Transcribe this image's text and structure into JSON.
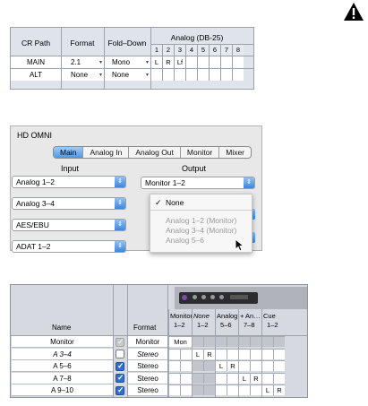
{
  "icons": {
    "warning": "warning-triangle-icon",
    "pointer": "mouse-pointer-icon",
    "checkmark": "checkmark-icon"
  },
  "colors": {
    "accent": "#4e98e8",
    "checked": "#2f6fd0"
  },
  "panel1": {
    "headers": {
      "cr_path": "CR Path",
      "format": "Format",
      "fold_down": "Fold–Down",
      "analog": "Analog (DB-25)"
    },
    "channels": [
      "1",
      "2",
      "3",
      "4",
      "5",
      "6",
      "7",
      "8"
    ],
    "rows": [
      {
        "name": "MAIN",
        "format": "2.1",
        "fold": "Mono",
        "assign": [
          "L",
          "R",
          "Lf",
          "",
          "",
          "",
          "",
          ""
        ]
      },
      {
        "name": "ALT",
        "format": "None",
        "fold": "None",
        "assign": [
          "",
          "",
          "",
          "",
          "",
          "",
          "",
          ""
        ]
      }
    ]
  },
  "panel2": {
    "title": "HD OMNI",
    "tabs": [
      "Main",
      "Analog In",
      "Analog Out",
      "Monitor",
      "Mixer"
    ],
    "selected_tab": "Main",
    "input_label": "Input",
    "output_label": "Output",
    "inputs": [
      "Analog 1–2",
      "Analog 3–4",
      "AES/EBU",
      "ADAT 1–2"
    ],
    "output_value": "Monitor 1–2",
    "menu": {
      "checked": "None",
      "disabled": [
        "Analog 1–2 (Monitor)",
        "Analog 3–4 (Monitor)",
        "Analog 5–6"
      ]
    }
  },
  "panel3": {
    "headers": {
      "name": "Name",
      "format": "Format"
    },
    "columns": [
      {
        "top": "Monitor",
        "bot": "1–2",
        "italic": false
      },
      {
        "top": "None",
        "bot": "1–2",
        "italic": true
      },
      {
        "top": "Analog",
        "bot": "5–6",
        "italic": false
      },
      {
        "top": "+ An…",
        "bot": "7–8",
        "italic": false
      },
      {
        "top": "Cue",
        "bot": "1–2",
        "italic": false
      }
    ],
    "rows": [
      {
        "name": "Monitor",
        "format": "Monitor",
        "checked": "dim",
        "italic": false,
        "assign": [
          "Mon",
          "",
          "",
          "",
          "",
          "",
          "",
          "",
          "",
          ""
        ]
      },
      {
        "name": "A 3–4",
        "format": "Stereo",
        "checked": "off",
        "italic": true,
        "assign": [
          "",
          "",
          "L",
          "R",
          "",
          "",
          "",
          "",
          "",
          ""
        ]
      },
      {
        "name": "A 5–6",
        "format": "Stereo",
        "checked": "on",
        "italic": false,
        "assign": [
          "",
          "",
          "",
          "",
          "L",
          "R",
          "",
          "",
          "",
          ""
        ]
      },
      {
        "name": "A 7–8",
        "format": "Stereo",
        "checked": "on",
        "italic": false,
        "assign": [
          "",
          "",
          "",
          "",
          "",
          "",
          "L",
          "R",
          "",
          ""
        ]
      },
      {
        "name": "A 9–10",
        "format": "Stereo",
        "checked": "on",
        "italic": false,
        "assign": [
          "",
          "",
          "",
          "",
          "",
          "",
          "",
          "",
          "L",
          "R"
        ]
      }
    ]
  }
}
